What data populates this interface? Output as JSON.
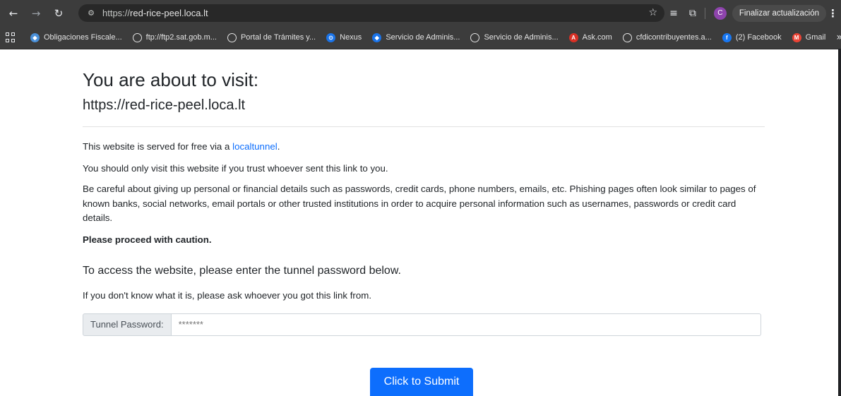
{
  "browser": {
    "back_icon": "arrow-left",
    "forward_icon": "arrow-right",
    "reload_icon": "reload",
    "url_scheme": "https://",
    "url_host": "red-rice-peel.loca.lt",
    "avatar_letter": "C",
    "update_label": "Finalizar actualización"
  },
  "bookmarks": [
    {
      "label": "Obligaciones Fiscale...",
      "icon": "sat-icon",
      "color": "#4a90d9"
    },
    {
      "label": "ftp://ftp2.sat.gob.m...",
      "icon": "globe-icon",
      "color": "#5f6368"
    },
    {
      "label": "Portal de Trámites y...",
      "icon": "globe-icon",
      "color": "#5f6368"
    },
    {
      "label": "Nexus",
      "icon": "nexus-icon",
      "color": "#1a73e8"
    },
    {
      "label": "Servicio de Adminis...",
      "icon": "sat-icon",
      "color": "#1a73e8"
    },
    {
      "label": "Servicio de Adminis...",
      "icon": "globe-icon",
      "color": "#5f6368"
    },
    {
      "label": "Ask.com",
      "icon": "ask-icon",
      "color": "#d93025"
    },
    {
      "label": "cfdicontribuyentes.a...",
      "icon": "globe-icon",
      "color": "#5f6368"
    },
    {
      "label": "(2) Facebook",
      "icon": "facebook-icon",
      "color": "#1877f2"
    },
    {
      "label": "Gmail",
      "icon": "gmail-icon",
      "color": "#ea4335"
    }
  ],
  "page": {
    "title": "You are about to visit:",
    "url": "https://red-rice-peel.loca.lt",
    "p1_prefix": "This website is served for free via a ",
    "p1_link": "localtunnel",
    "p1_suffix": ".",
    "p2": "You should only visit this website if you trust whoever sent this link to you.",
    "p3": "Be careful about giving up personal or financial details such as passwords, credit cards, phone numbers, emails, etc. Phishing pages often look similar to pages of known banks, social networks, email portals or other trusted institutions in order to acquire personal information such as usernames, passwords or credit card details.",
    "p4": "Please proceed with caution.",
    "subheading": "To access the website, please enter the tunnel password below.",
    "p5": "If you don't know what it is, please ask whoever you got this link from.",
    "password_label": "Tunnel Password:",
    "password_placeholder": "*******",
    "submit_label": "Click to Submit"
  },
  "colors": {
    "accent": "#0d6efd",
    "toolbar": "#3c3c3c"
  }
}
